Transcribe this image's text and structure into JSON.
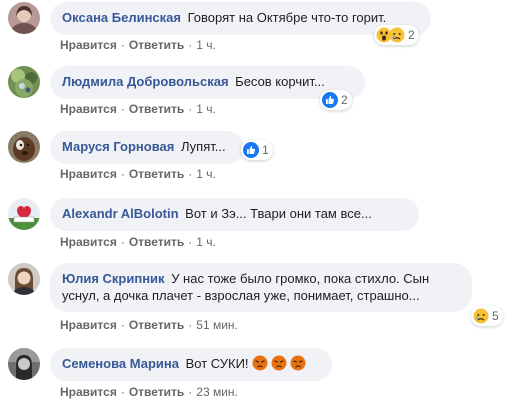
{
  "actions": {
    "like_label": "Нравится",
    "reply_label": "Ответить",
    "separator": "·"
  },
  "comments": [
    {
      "author": "Оксана Белинская",
      "text": "Говорят на Октябре что-то горит.",
      "time": "1 ч.",
      "reactions": [
        "wow-icon",
        "sad-icon"
      ],
      "reaction_count": "2"
    },
    {
      "author": "Людмила Добровольская",
      "text": "Бесов корчит...",
      "time": "1 ч.",
      "reactions": [
        "like-icon"
      ],
      "reaction_count": "2"
    },
    {
      "author": "Маруся Горновая",
      "text": "Лупят...",
      "time": "1 ч.",
      "reactions": [
        "like-icon"
      ],
      "reaction_count": "1"
    },
    {
      "author": "Alexandr AlBolotin",
      "text": "Вот и Зэ... Твари они там все...",
      "time": "1 ч."
    },
    {
      "author": "Юлия Скрипник",
      "text": "У нас тоже было громко, пока стихло. Сын уснул, а дочка плачет - взрослая уже, понимает, страшно...",
      "time": "51 мин.",
      "reactions": [
        "sad-icon"
      ],
      "reaction_count": "5"
    },
    {
      "author": "Семенова Марина",
      "text": "Вот СУКИ!",
      "emoji": [
        "angry-emoji",
        "angry-emoji",
        "angry-emoji"
      ],
      "time": "23 мин."
    }
  ],
  "colors": {
    "author": "#385898",
    "bubble": "#f0f2f5",
    "meta": "#65676b",
    "like_blue": "#1877f2",
    "emoji_yellow": "#f7c236",
    "angry_orange": "#e9710f"
  }
}
